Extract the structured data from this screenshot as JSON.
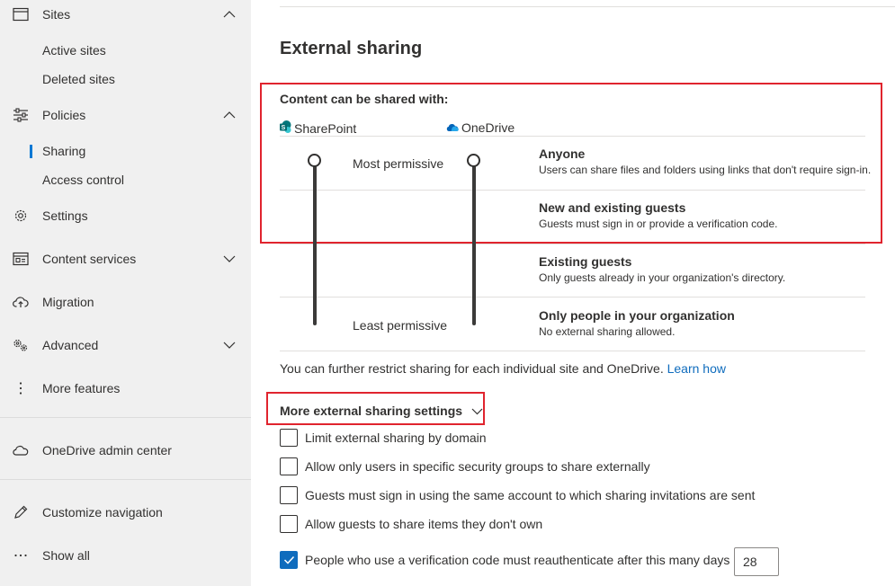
{
  "sidebar": {
    "items": [
      {
        "label": "Sites",
        "icon": "browser-window-icon",
        "expanded": true
      },
      {
        "label": "Active sites"
      },
      {
        "label": "Deleted sites"
      },
      {
        "label": "Policies",
        "icon": "sliders-icon",
        "expanded": true
      },
      {
        "label": "Sharing",
        "active": true
      },
      {
        "label": "Access control"
      },
      {
        "label": "Settings",
        "icon": "gear-icon"
      },
      {
        "label": "Content services",
        "icon": "content-services-icon",
        "expanded": false
      },
      {
        "label": "Migration",
        "icon": "cloud-upload-icon"
      },
      {
        "label": "Advanced",
        "icon": "advanced-gears-icon",
        "expanded": false
      },
      {
        "label": "More features",
        "icon": "vertical-ellipsis-icon"
      },
      {
        "label": "OneDrive admin center",
        "icon": "onedrive-cloud-icon"
      },
      {
        "label": "Customize navigation",
        "icon": "pencil-icon"
      },
      {
        "label": "Show all",
        "icon": "horizontal-ellipsis-icon"
      }
    ]
  },
  "main": {
    "title": "External sharing",
    "content_heading": "Content can be shared with:",
    "sharepoint_label": "SharePoint",
    "onedrive_label": "OneDrive",
    "most_permissive": "Most permissive",
    "least_permissive": "Least permissive",
    "levels": [
      {
        "title": "Anyone",
        "desc": "Users can share files and folders using links that don't require sign-in."
      },
      {
        "title": "New and existing guests",
        "desc": "Guests must sign in or provide a verification code."
      },
      {
        "title": "Existing guests",
        "desc": "Only guests already in your organization's directory."
      },
      {
        "title": "Only people in your organization",
        "desc": "No external sharing allowed."
      }
    ],
    "restrict_text": "You can further restrict sharing for each individual site and OneDrive.",
    "learn_how": "Learn how",
    "more_settings_title": "More external sharing settings",
    "checkboxes": [
      {
        "label": "Limit external sharing by domain",
        "checked": false
      },
      {
        "label": "Allow only users in specific security groups to share externally",
        "checked": false
      },
      {
        "label": "Guests must sign in using the same account to which sharing invitations are sent",
        "checked": false
      },
      {
        "label": "Allow guests to share items they don't own",
        "checked": false
      },
      {
        "label": "People who use a verification code must reauthenticate after this many days",
        "checked": true
      }
    ],
    "reauth_days": "28"
  },
  "colors": {
    "accent": "#0f6cbd",
    "highlight_box": "#e0242e",
    "sidebar_bg": "#f0f0f0",
    "sharepoint_green": "#03787c",
    "onedrive_blue": "#0364b8"
  }
}
